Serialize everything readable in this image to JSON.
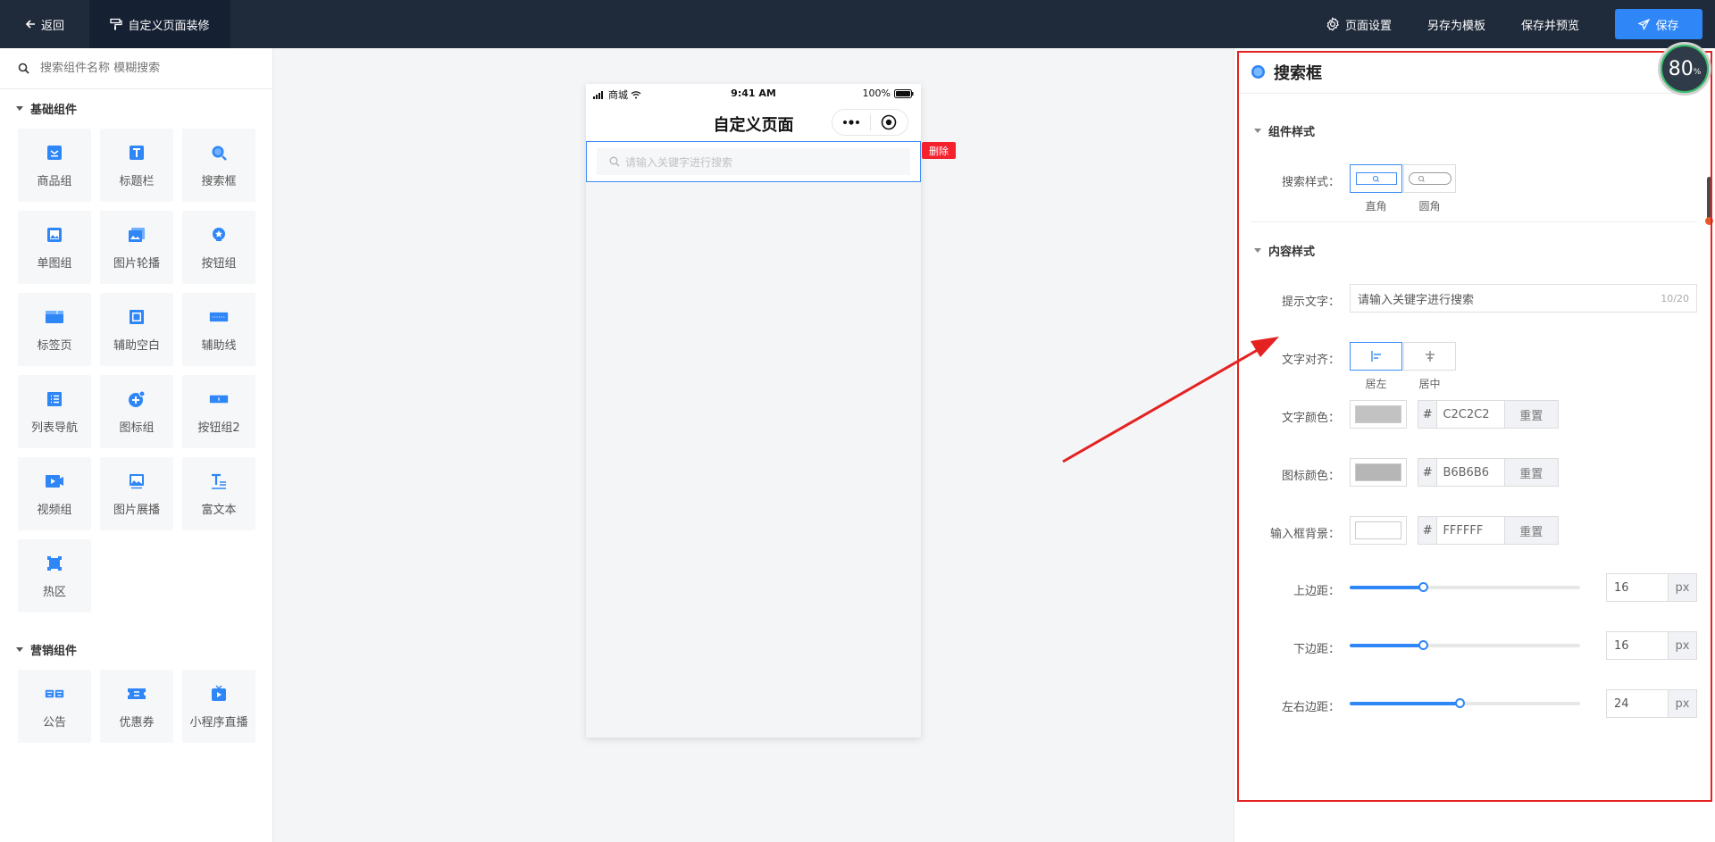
{
  "topbar": {
    "back_label": "返回",
    "page_title": "自定义页面装修",
    "page_settings_label": "页面设置",
    "save_template_label": "另存为模板",
    "save_preview_label": "保存并预览",
    "save_label": "保存"
  },
  "left": {
    "search_placeholder": "搜索组件名称 模糊搜索",
    "basic_title": "基础组件",
    "basic_items": [
      {
        "label": "商品组",
        "icon": "goods-group-icon"
      },
      {
        "label": "标题栏",
        "icon": "title-bar-icon"
      },
      {
        "label": "搜索框",
        "icon": "search-box-icon"
      },
      {
        "label": "单图组",
        "icon": "single-image-icon"
      },
      {
        "label": "图片轮播",
        "icon": "image-carousel-icon"
      },
      {
        "label": "按钮组",
        "icon": "button-group-icon"
      },
      {
        "label": "标签页",
        "icon": "tabs-icon"
      },
      {
        "label": "辅助空白",
        "icon": "blank-space-icon"
      },
      {
        "label": "辅助线",
        "icon": "divider-line-icon"
      },
      {
        "label": "列表导航",
        "icon": "list-nav-icon"
      },
      {
        "label": "图标组",
        "icon": "icon-group-icon"
      },
      {
        "label": "按钮组2",
        "icon": "button-group2-icon"
      },
      {
        "label": "视频组",
        "icon": "video-group-icon"
      },
      {
        "label": "图片展播",
        "icon": "image-showcase-icon"
      },
      {
        "label": "富文本",
        "icon": "rich-text-icon"
      },
      {
        "label": "热区",
        "icon": "hotspot-icon"
      }
    ],
    "marketing_title": "营销组件",
    "marketing_items": [
      {
        "label": "公告",
        "icon": "notice-icon"
      },
      {
        "label": "优惠券",
        "icon": "coupon-icon"
      },
      {
        "label": "小程序直播",
        "icon": "live-stream-icon"
      }
    ]
  },
  "phone": {
    "carrier": "商城",
    "time": "9:41 AM",
    "battery": "100%",
    "nav_title": "自定义页面",
    "search_placeholder": "请输入关键字进行搜索",
    "delete_label": "删除"
  },
  "right": {
    "title": "搜索框",
    "component_style_title": "组件样式",
    "search_style_label": "搜索样式：",
    "style_options": [
      "直角",
      "圆角"
    ],
    "content_style_title": "内容样式",
    "placeholder_label": "提示文字：",
    "placeholder_value": "请输入关键字进行搜索",
    "placeholder_counter": "10/20",
    "text_align_label": "文字对齐：",
    "align_options": [
      "居左",
      "居中"
    ],
    "text_color_label": "文字颜色：",
    "text_color_hex": "C2C2C2",
    "icon_color_label": "图标颜色：",
    "icon_color_hex": "B6B6B6",
    "input_bg_label": "输入框背景：",
    "input_bg_hex": "FFFFFF",
    "hash": "#",
    "reset_label": "重置",
    "margin_top_label": "上边距：",
    "margin_top_value": "16",
    "margin_bottom_label": "下边距：",
    "margin_bottom_value": "16",
    "margin_lr_label": "左右边距：",
    "margin_lr_value": "24",
    "unit": "px"
  },
  "sliders": {
    "margin_top_fraction": 0.32,
    "margin_bottom_fraction": 0.32,
    "margin_lr_fraction": 0.48
  },
  "zoom": {
    "value": "80",
    "unit": "%"
  },
  "colors": {
    "accent": "#2f86f6",
    "topbar_bg": "#1f2a3a",
    "text_color": "#C2C2C2",
    "icon_color": "#B6B6B6",
    "input_bg": "#FFFFFF",
    "annotation_red": "#e52222",
    "delete_red": "#f5222d"
  }
}
